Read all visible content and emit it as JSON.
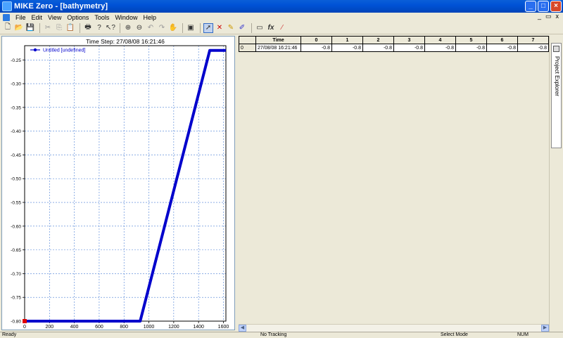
{
  "window": {
    "title": "MIKE Zero - [bathymetry]",
    "minimize_icon": "minimize-icon",
    "maximize_icon": "maximize-icon",
    "close_icon": "close-icon"
  },
  "menu": {
    "items": [
      "File",
      "Edit",
      "View",
      "Options",
      "Tools",
      "Window",
      "Help"
    ],
    "mdi_controls": [
      "_",
      "▭",
      "x"
    ]
  },
  "toolbar": {
    "icons": [
      "new-icon",
      "open-icon",
      "save-icon",
      "cut-icon",
      "copy-icon",
      "paste-icon",
      "print-icon",
      "help-icon",
      "context-help-icon",
      "zoom-in-icon",
      "zoom-out-icon",
      "zoom-previous-icon",
      "zoom-next-icon",
      "pan-icon",
      "zoom-extent-icon",
      "select-icon",
      "select-points-icon",
      "edit-points-icon",
      "draw-icon",
      "rectangle-icon",
      "function-icon",
      "line-icon"
    ],
    "function_label": "fx"
  },
  "chart_data": {
    "type": "line",
    "title": "Time Step: 27/08/08 16:21:46",
    "series": [
      {
        "name": "Untitled [undefined]",
        "color": "#0000cc",
        "x": [
          0,
          930,
          1490,
          1620
        ],
        "y": [
          -0.8,
          -0.8,
          -0.23,
          -0.23
        ]
      }
    ],
    "xlim": [
      0,
      1620
    ],
    "ylim": [
      -0.8,
      -0.22
    ],
    "xticks": [
      0,
      200,
      400,
      600,
      800,
      1000,
      1200,
      1400,
      1600
    ],
    "yticks": [
      -0.8,
      -0.75,
      -0.7,
      -0.65,
      -0.6,
      -0.55,
      -0.5,
      -0.45,
      -0.4,
      -0.35,
      -0.3,
      -0.25
    ],
    "ytick_labels": [
      "-0.80",
      "-0.75",
      "-0.70",
      "-0.65",
      "-0.60",
      "-0.55",
      "-0.50",
      "-0.45",
      "-0.40",
      "-0.35",
      "-0.30",
      "-0.25"
    ],
    "grid": true,
    "legend": "top-left"
  },
  "grid": {
    "headers": [
      "",
      "Time",
      "0",
      "1",
      "2",
      "3",
      "4",
      "5",
      "6",
      "7"
    ],
    "rows": [
      {
        "index": "0",
        "time": "27/08/08 16:21:46",
        "values": [
          "-0.8",
          "-0.8",
          "-0.8",
          "-0.8",
          "-0.8",
          "-0.8",
          "-0.8",
          "-0.8"
        ]
      }
    ]
  },
  "side_panel": {
    "label": "Project Explorer"
  },
  "statusbar": {
    "ready": "Ready",
    "tracking": "No Tracking",
    "mode": "Select Mode",
    "num": "NUM"
  }
}
